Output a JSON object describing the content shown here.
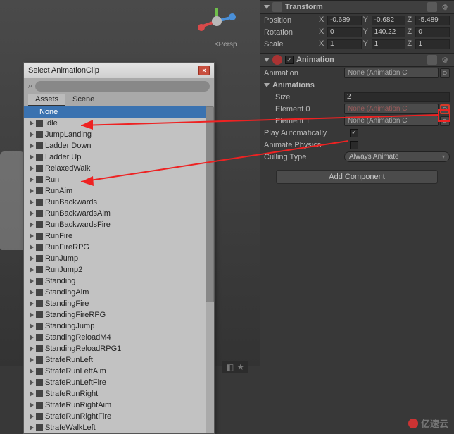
{
  "scene": {
    "perspLabel": "≤Persp",
    "axes": {
      "x": "x",
      "y": "y",
      "z": "z"
    }
  },
  "picker": {
    "title": "Select AnimationClip",
    "searchPlaceholder": "",
    "tabs": {
      "assets": "Assets",
      "scene": "Scene"
    },
    "noneLabel": "None",
    "items": [
      "Idle",
      "JumpLanding",
      "Ladder Down",
      "Ladder Up",
      "RelaxedWalk",
      "Run",
      "RunAim",
      "RunBackwards",
      "RunBackwardsAim",
      "RunBackwardsFire",
      "RunFire",
      "RunFireRPG",
      "RunJump",
      "RunJump2",
      "Standing",
      "StandingAim",
      "StandingFire",
      "StandingFireRPG",
      "StandingJump",
      "StandingReloadM4",
      "StandingReloadRPG1",
      "StrafeRunLeft",
      "StrafeRunLeftAim",
      "StrafeRunLeftFire",
      "StrafeRunRight",
      "StrafeRunRightAim",
      "StrafeRunRightFire",
      "StrafeWalkLeft"
    ]
  },
  "inspector": {
    "transform": {
      "title": "Transform",
      "position": {
        "label": "Position",
        "x": "-0.689",
        "y": "-0.682",
        "z": "-5.489"
      },
      "rotation": {
        "label": "Rotation",
        "x": "0",
        "y": "140.22",
        "z": "0"
      },
      "scale": {
        "label": "Scale",
        "x": "1",
        "y": "1",
        "z": "1"
      }
    },
    "animation": {
      "title": "Animation",
      "animationLabel": "Animation",
      "animationValue": "None (Animation C",
      "animationsLabel": "Animations",
      "sizeLabel": "Size",
      "sizeValue": "2",
      "element0Label": "Element 0",
      "element0Value": "None (Animation C",
      "element1Label": "Element 1",
      "element1Value": "None (Animation C",
      "playAutoLabel": "Play Automatically",
      "animatePhysicsLabel": "Animate Physics",
      "cullingLabel": "Culling Type",
      "cullingValue": "Always Animate"
    },
    "addComponent": "Add Component"
  },
  "axisLabels": {
    "x": "X",
    "y": "Y",
    "z": "Z"
  },
  "watermark": "亿速云"
}
